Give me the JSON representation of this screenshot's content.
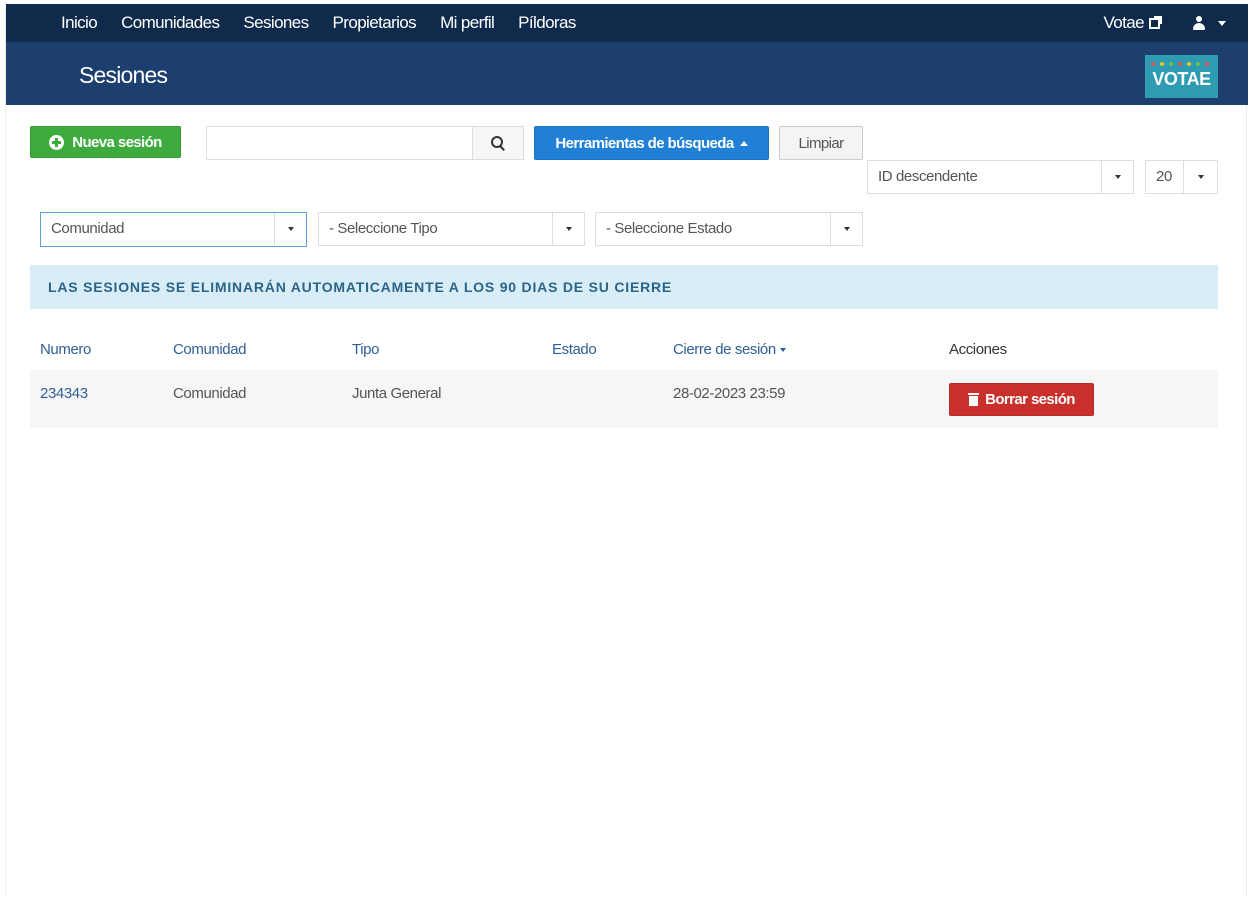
{
  "nav": {
    "items": [
      "Inicio",
      "Comunidades",
      "Sesiones",
      "Propietarios",
      "Mi perfil",
      "Píldoras"
    ],
    "votae_link": "Votae"
  },
  "header": {
    "title": "Sesiones",
    "logo_text": "VOTAE",
    "logo_dot_colors": [
      "#e84d4d",
      "#f0c419",
      "#6cc04a",
      "#e84d4d",
      "#f0c419",
      "#6cc04a",
      "#e84d4d"
    ]
  },
  "toolbar": {
    "new_session_label": "Nueva sesión",
    "search_placeholder": "",
    "search_value": "",
    "search_tools_label": "Herramientas de búsqueda",
    "clear_label": "Limpiar",
    "order_select": "ID descendente",
    "page_size_select": "20"
  },
  "filters": {
    "community": "Comunidad",
    "type": "- Seleccione Tipo",
    "status": "- Seleccione Estado"
  },
  "alert": {
    "text": "LAS SESIONES SE ELIMINARÁN AUTOMATICAMENTE A LOS 90 DIAS DE SU CIERRE"
  },
  "table": {
    "headers": [
      "Numero",
      "Comunidad",
      "Tipo",
      "Estado",
      "Cierre de sesión",
      "Acciones"
    ],
    "rows": [
      {
        "numero": "234343",
        "comunidad": "Comunidad",
        "tipo": "Junta General",
        "estado": "",
        "cierre": "28-02-2023 23:59",
        "action_label": "Borrar sesión"
      }
    ]
  },
  "colors": {
    "navbar": "#102a4c",
    "header": "#1c3f70",
    "success": "#3eab3f",
    "primary": "#1f80d6",
    "danger": "#c9302c",
    "info_bg": "#d9edf7"
  }
}
